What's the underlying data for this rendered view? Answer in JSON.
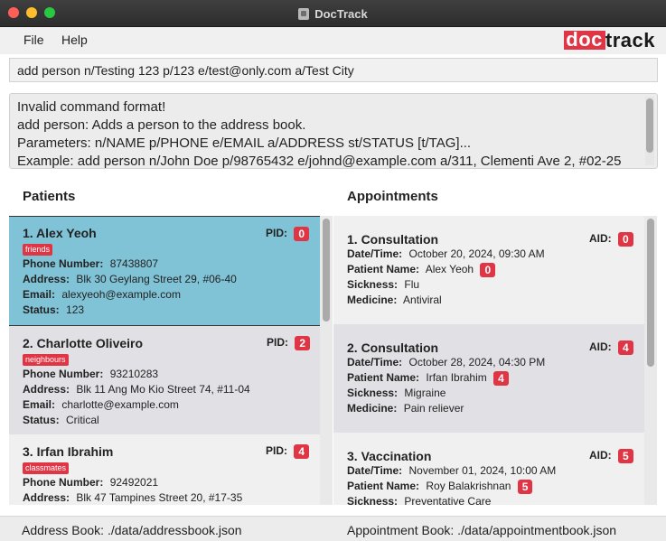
{
  "window": {
    "title": "DocTrack"
  },
  "menu": {
    "file": "File",
    "help": "Help"
  },
  "logo": {
    "part1": "doc",
    "part2": "track"
  },
  "command": {
    "value": "add person n/Testing 123 p/123 e/test@only.com a/Test City"
  },
  "result": {
    "lines": [
      "Invalid command format!",
      "add person: Adds a person to the address book.",
      "Parameters: n/NAME p/PHONE e/EMAIL a/ADDRESS st/STATUS [t/TAG]...",
      "Example: add person n/John Doe p/98765432 e/johnd@example.com a/311, Clementi Ave 2, #02-25"
    ]
  },
  "patients": {
    "header": "Patients",
    "id_label": "PID:",
    "labels": {
      "phone": "Phone Number:",
      "address": "Address:",
      "email": "Email:",
      "status": "Status:"
    },
    "items": [
      {
        "name": "1. Alex Yeoh",
        "tag": "friends",
        "pid": "0",
        "phone": "87438807",
        "address": "Blk 30 Geylang Street 29, #06-40",
        "email": "alexyeoh@example.com",
        "status": "123"
      },
      {
        "name": "2. Charlotte Oliveiro",
        "tag": "neighbours",
        "pid": "2",
        "phone": "93210283",
        "address": "Blk 11 Ang Mo Kio Street 74, #11-04",
        "email": "charlotte@example.com",
        "status": "Critical"
      },
      {
        "name": "3. Irfan Ibrahim",
        "tag": "classmates",
        "pid": "4",
        "phone": "92492021",
        "address": "Blk 47 Tampines Street 20, #17-35"
      }
    ]
  },
  "appointments": {
    "header": "Appointments",
    "id_label": "AID:",
    "labels": {
      "datetime": "Date/Time:",
      "patient": "Patient Name:",
      "sickness": "Sickness:",
      "medicine": "Medicine:"
    },
    "items": [
      {
        "title": "1. Consultation",
        "aid": "0",
        "datetime": "October 20, 2024, 09:30 AM",
        "patient": "Alex Yeoh",
        "patient_id": "0",
        "sickness": "Flu",
        "medicine": "Antiviral"
      },
      {
        "title": "2. Consultation",
        "aid": "4",
        "datetime": "October 28, 2024, 04:30 PM",
        "patient": "Irfan Ibrahim",
        "patient_id": "4",
        "sickness": "Migraine",
        "medicine": "Pain reliever"
      },
      {
        "title": "3. Vaccination",
        "aid": "5",
        "datetime": "November 01, 2024, 10:00 AM",
        "patient": "Roy Balakrishnan",
        "patient_id": "5",
        "sickness": "Preventative Care"
      }
    ]
  },
  "status_bar": {
    "address_book": "Address Book: ./data/addressbook.json",
    "appointment_book": "Appointment Book: ./data/appointmentbook.json"
  }
}
